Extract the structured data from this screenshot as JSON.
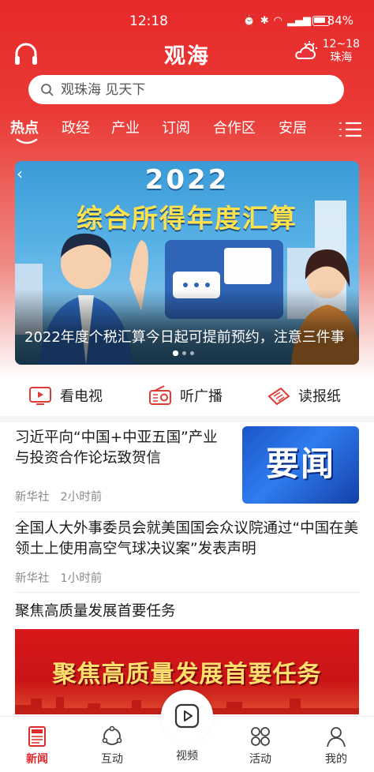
{
  "status_bar": {
    "time": "12:18",
    "battery": "84%"
  },
  "header": {
    "title": "观海",
    "weather": {
      "temp": "12~18",
      "city": "珠海"
    }
  },
  "search": {
    "placeholder": "观珠海 见天下"
  },
  "tabs": [
    {
      "label": "热点",
      "active": true
    },
    {
      "label": "政经"
    },
    {
      "label": "产业"
    },
    {
      "label": "订阅"
    },
    {
      "label": "合作区"
    },
    {
      "label": "安居"
    }
  ],
  "banner": {
    "year": "2022",
    "headline": "综合所得年度汇算",
    "caption": "2022年度个税汇算今日起可提前预约，注意三件事",
    "page_count": 3,
    "current_page": 1
  },
  "media": [
    {
      "label": "看电视",
      "icon": "tv-icon"
    },
    {
      "label": "听广播",
      "icon": "radio-icon"
    },
    {
      "label": "读报纸",
      "icon": "newspaper-icon"
    }
  ],
  "news": [
    {
      "title": "习近平向“中国+中亚五国”产业与投资合作论坛致贺信",
      "source": "新华社",
      "time": "2小时前",
      "thumb_text": "要闻"
    },
    {
      "title": "全国人大外事委员会就美国国会众议院通过“中国在美领土上使用高空气球决议案”发表声明",
      "source": "新华社",
      "time": "1小时前"
    }
  ],
  "feature": {
    "title": "聚焦高质量发展首要任务",
    "banner_text": "聚焦高质量发展首要任务"
  },
  "bottom_nav": [
    {
      "label": "新闻",
      "active": true
    },
    {
      "label": "互动"
    },
    {
      "label": "视频"
    },
    {
      "label": "活动"
    },
    {
      "label": "我的"
    }
  ],
  "colors": {
    "brand_red": "#e62a2a",
    "accent_yellow": "#ffe14d"
  }
}
